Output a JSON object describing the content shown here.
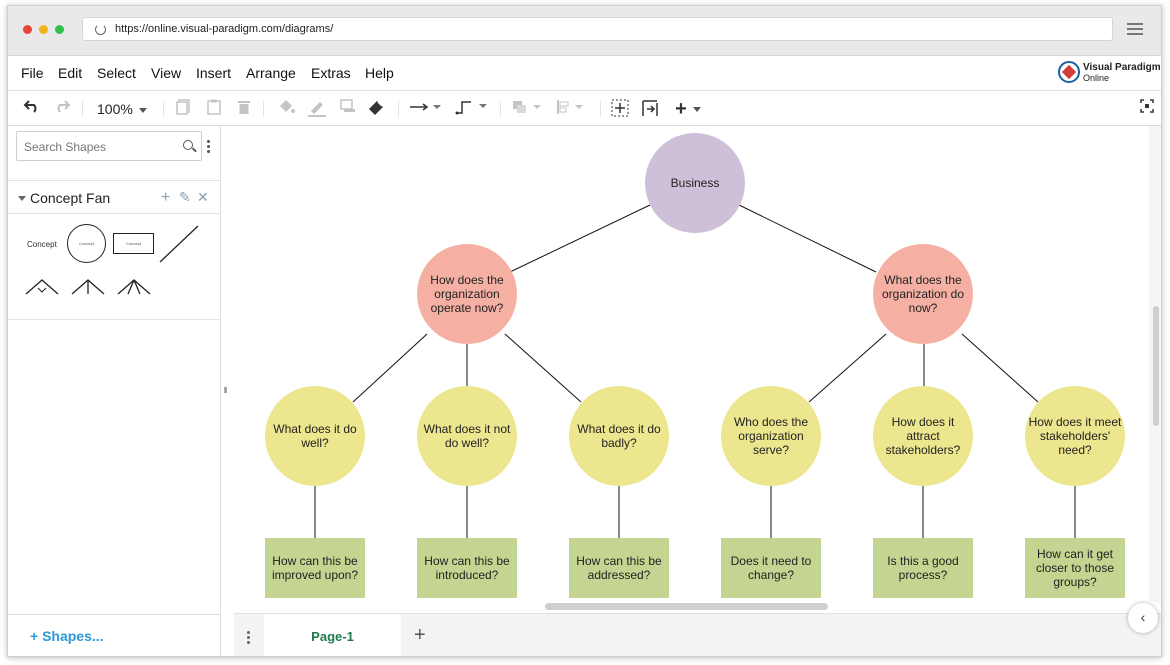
{
  "browser": {
    "url": "https://online.visual-paradigm.com/diagrams/"
  },
  "menu": [
    "File",
    "Edit",
    "Select",
    "View",
    "Insert",
    "Arrange",
    "Extras",
    "Help"
  ],
  "logo": {
    "line1": "Visual Paradigm",
    "line2": "Online"
  },
  "toolbar": {
    "zoom": "100%",
    "undo_icon": "undo-icon",
    "redo_icon": "redo-icon",
    "fill_icon": "fill-bucket-icon",
    "line_color_icon": "line-color-icon",
    "shadow_icon": "shadow-icon",
    "format_painter_icon": "format-painter-icon",
    "insert_plus": "+"
  },
  "sidebar": {
    "search_placeholder": "Search Shapes",
    "library_title": "Concept Fan",
    "shape_concept_label": "Concept",
    "shape_circle_label": "Concept",
    "shape_rect_label": "Concept",
    "footer_link": "Shapes..."
  },
  "pages": {
    "current": "Page-1"
  },
  "diagram": {
    "root": "Business",
    "level1": [
      "How does the organization operate now?",
      "What does the organization do now?"
    ],
    "level2": [
      "What does it do well?",
      "What does it not do well?",
      "What does it do badly?",
      "Who does the organization serve?",
      "How does it attract stakeholders?",
      "How does it meet stakeholders' need?"
    ],
    "level3": [
      "How can this be improved upon?",
      "How can this be introduced?",
      "How can this be addressed?",
      "Does it need to change?",
      "Is this a good process?",
      "How can it get closer to those groups?"
    ],
    "colors": {
      "root": "#cdc0d8",
      "level1": "#f6b0a3",
      "level2": "#ece68e",
      "level3": "#c3d591"
    }
  }
}
